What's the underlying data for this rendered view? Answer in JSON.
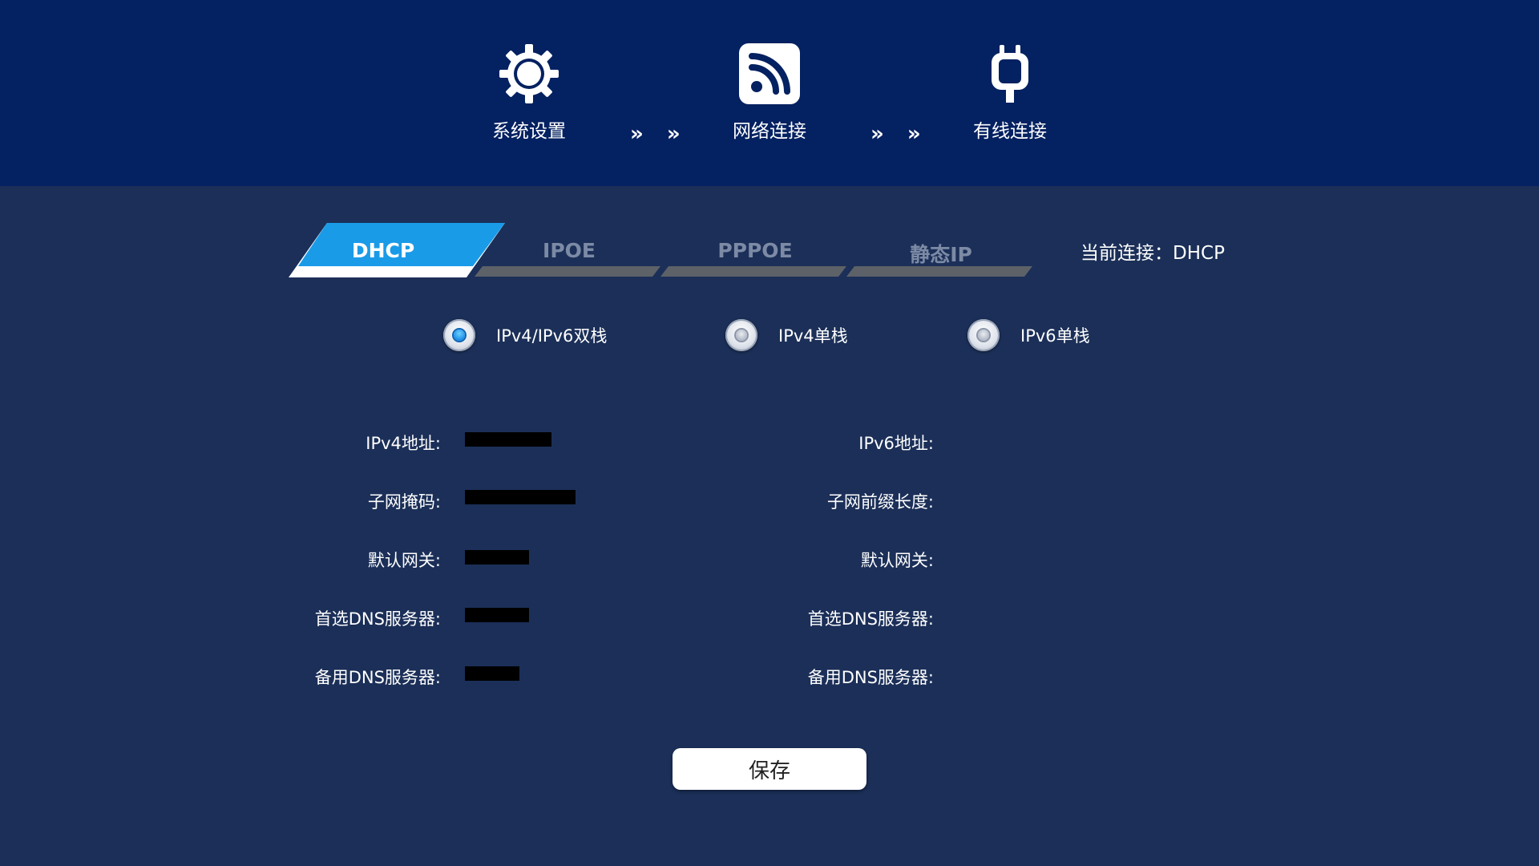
{
  "breadcrumb": {
    "items": [
      {
        "label": "系统设置",
        "icon": "gear-icon"
      },
      {
        "label": "网络连接",
        "icon": "rss-icon"
      },
      {
        "label": "有线连接",
        "icon": "plug-icon"
      }
    ],
    "separator": "» »"
  },
  "tabs": [
    {
      "label": "DHCP",
      "active": true
    },
    {
      "label": "IPOE",
      "active": false
    },
    {
      "label": "PPPOE",
      "active": false
    },
    {
      "label": "静态IP",
      "active": false
    }
  ],
  "current_connection": "当前连接：DHCP",
  "ip_modes": [
    {
      "label": "IPv4/IPv6双栈",
      "selected": true
    },
    {
      "label": "IPv4单栈",
      "selected": false
    },
    {
      "label": "IPv6单栈",
      "selected": false
    }
  ],
  "ipv4": {
    "address_label": "IPv4地址:",
    "address_value": "",
    "subnet_label": "子网掩码:",
    "subnet_value": "",
    "gateway_label": "默认网关:",
    "gateway_value": "",
    "dns1_label": "首选DNS服务器:",
    "dns1_value": "",
    "dns2_label": "备用DNS服务器:",
    "dns2_value": ""
  },
  "ipv6": {
    "address_label": "IPv6地址:",
    "prefix_label": "子网前缀长度:",
    "gateway_label": "默认网关:",
    "dns1_label": "首选DNS服务器:",
    "dns2_label": "备用DNS服务器:"
  },
  "save_label": "保存",
  "colors": {
    "header_bg": "#042161",
    "body_bg": "#1b2f58",
    "tab_active": "#1a9be8",
    "tab_inactive_bar": "#5d6268",
    "radio_selected": "#1b8fe6"
  }
}
